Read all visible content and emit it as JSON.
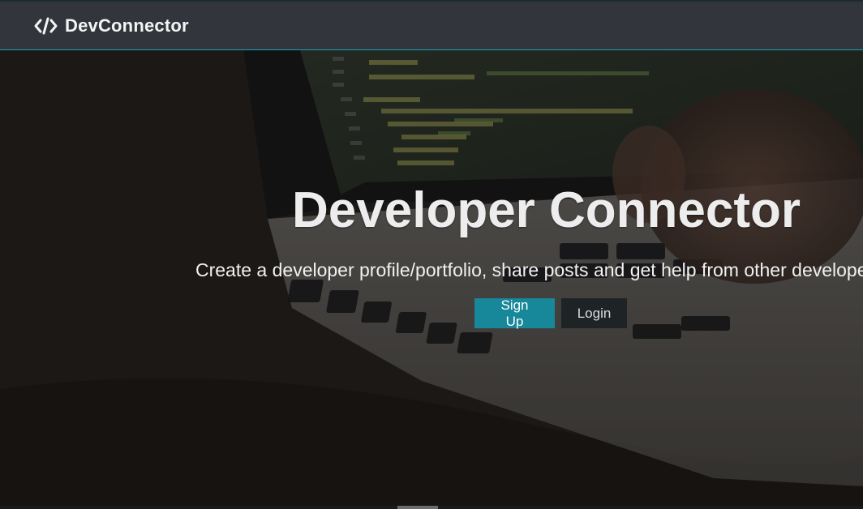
{
  "navbar": {
    "brand_label": "DevConnector",
    "brand_icon": "code-icon"
  },
  "hero": {
    "title": "Developer Connector",
    "lead": "Create a developer profile/portfolio, share posts and get help from other developers",
    "buttons": {
      "signup_label": "Sign Up",
      "login_label": "Login"
    }
  },
  "colors": {
    "navbar_bg": "#343a40",
    "accent": "#17a2b8",
    "primary_button": "#17879a",
    "light_button": "#1e2326",
    "text": "#f4f4f4"
  }
}
